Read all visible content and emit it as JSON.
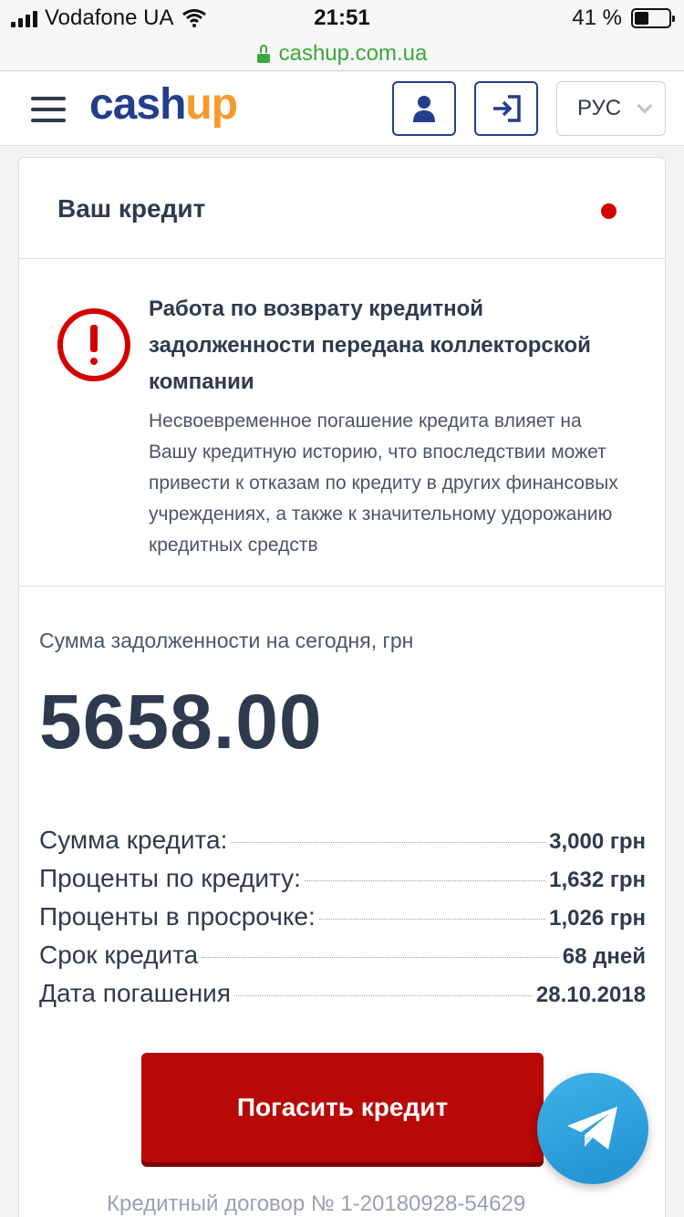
{
  "status_bar": {
    "carrier": "Vodafone UA",
    "time": "21:51",
    "battery": "41 %",
    "battery_level": 0.41
  },
  "browser": {
    "url": "cashup.com.ua"
  },
  "header": {
    "logo_part1": "cash",
    "logo_part2": "up",
    "language": "РУС"
  },
  "card": {
    "title": "Ваш кредит",
    "alert": {
      "title": "Работа по возврату кредитной задолженности передана коллекторской компании",
      "text": "Несвоевременное погашение кредита влияет на Вашу кредитную историю, что впоследствии может привести к отказам по кредиту в других финансовых учреждениях, а также к значительному удорожанию кредитных средств"
    },
    "debt_label": "Сумма задолженности на сегодня, грн",
    "debt_amount": "5658.00",
    "details": [
      {
        "label": "Сумма кредита:",
        "value": "3,000 грн"
      },
      {
        "label": "Проценты по кредиту:",
        "value": "1,632 грн"
      },
      {
        "label": "Проценты в просрочке:",
        "value": "1,026 грн"
      },
      {
        "label": "Срок кредита",
        "value": "68 дней"
      },
      {
        "label": "Дата погашения",
        "value": "28.10.2018"
      }
    ],
    "pay_button": "Погасить кредит",
    "contract": "Кредитный договор № 1-20180928-54629"
  },
  "colors": {
    "brand_blue": "#243e8c",
    "brand_orange": "#f59b2a",
    "alert_red": "#d40000",
    "button_red": "#b80808",
    "telegram_blue": "#2ea2de"
  }
}
